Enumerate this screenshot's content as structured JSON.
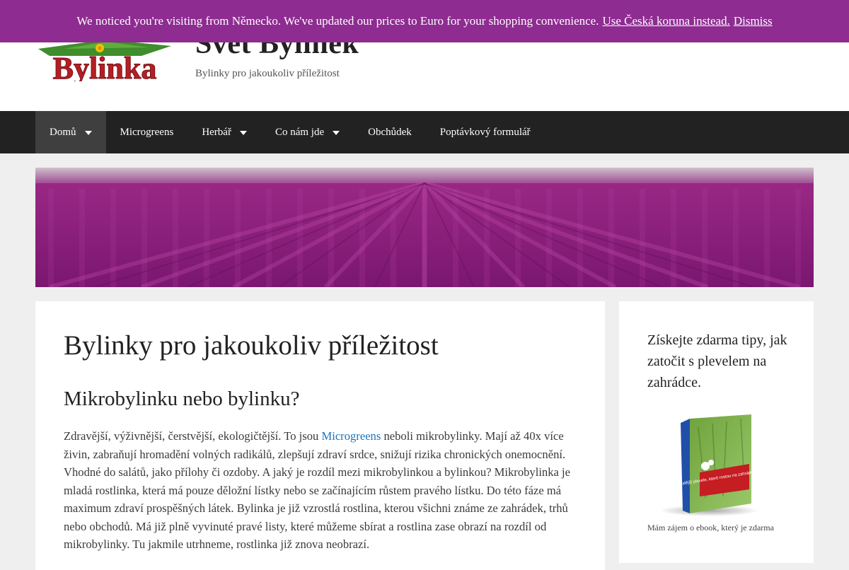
{
  "notice": {
    "message": "We noticed you're visiting from Německo. We've updated our prices to Euro for your shopping convenience.",
    "currency_link": "Use Česká koruna instead.",
    "dismiss": "Dismiss"
  },
  "header": {
    "logo_text": "Bylinka",
    "site_title": "Svět Bylinek",
    "tagline": "Bylinky pro jakoukoliv příležitost"
  },
  "nav": {
    "items": [
      {
        "label": "Domů",
        "has_dropdown": true,
        "active": true
      },
      {
        "label": "Microgreens",
        "has_dropdown": false
      },
      {
        "label": "Herbář",
        "has_dropdown": true
      },
      {
        "label": "Co nám jde",
        "has_dropdown": true
      },
      {
        "label": "Obchůdek",
        "has_dropdown": false
      },
      {
        "label": "Poptávkový formulář",
        "has_dropdown": false
      }
    ]
  },
  "main": {
    "title": "Bylinky pro jakoukoliv příležitost",
    "subtitle": "Mikrobylinku nebo bylinku?",
    "para_start": "Zdravější, výživnější, čerstvější, ekologičtější. To jsou ",
    "para_link": "Microgreens",
    "para_end": " neboli mikrobylinky. Mají až 40x více živin, zabraňují hromadění volných radikálů, zlepšují zdraví srdce, snižují rizika chronických onemocnění. Vhodné do salátů, jako přílohy či ozdoby. A jaký je rozdíl mezi mikrobylinkou a bylinkou? Mikrobylinka je mladá rostlinka, která má pouze děložní lístky nebo se začínajícím růstem pravého lístku. Do této fáze má maximum zdraví prospěšných látek. Bylinka je již vzrostlá rostlina, kterou všichni známe ze zahrádek, trhů nebo obchodů. Má již plně vyvinuté pravé listy, které můžeme sbírat a rostlina zase obrazí na rozdíl od mikrobylinky. Tu jakmile utrhneme, rostlinka již znova neobrazí."
  },
  "sidebar": {
    "widget_title": "Získejte zdarma tipy, jak zatočit s plevelem na zahrádce.",
    "ebook_cover_text": "Nejčastější plevele, které rostou na zahrádce a jak na ně",
    "caption": "Mám zájem o ebook, který je zdarma"
  },
  "colors": {
    "notice_bg": "#8e2c91",
    "nav_bg": "#222222",
    "nav_active": "#3f3f3f",
    "link": "#1e73be",
    "page_bg": "#efefef"
  }
}
